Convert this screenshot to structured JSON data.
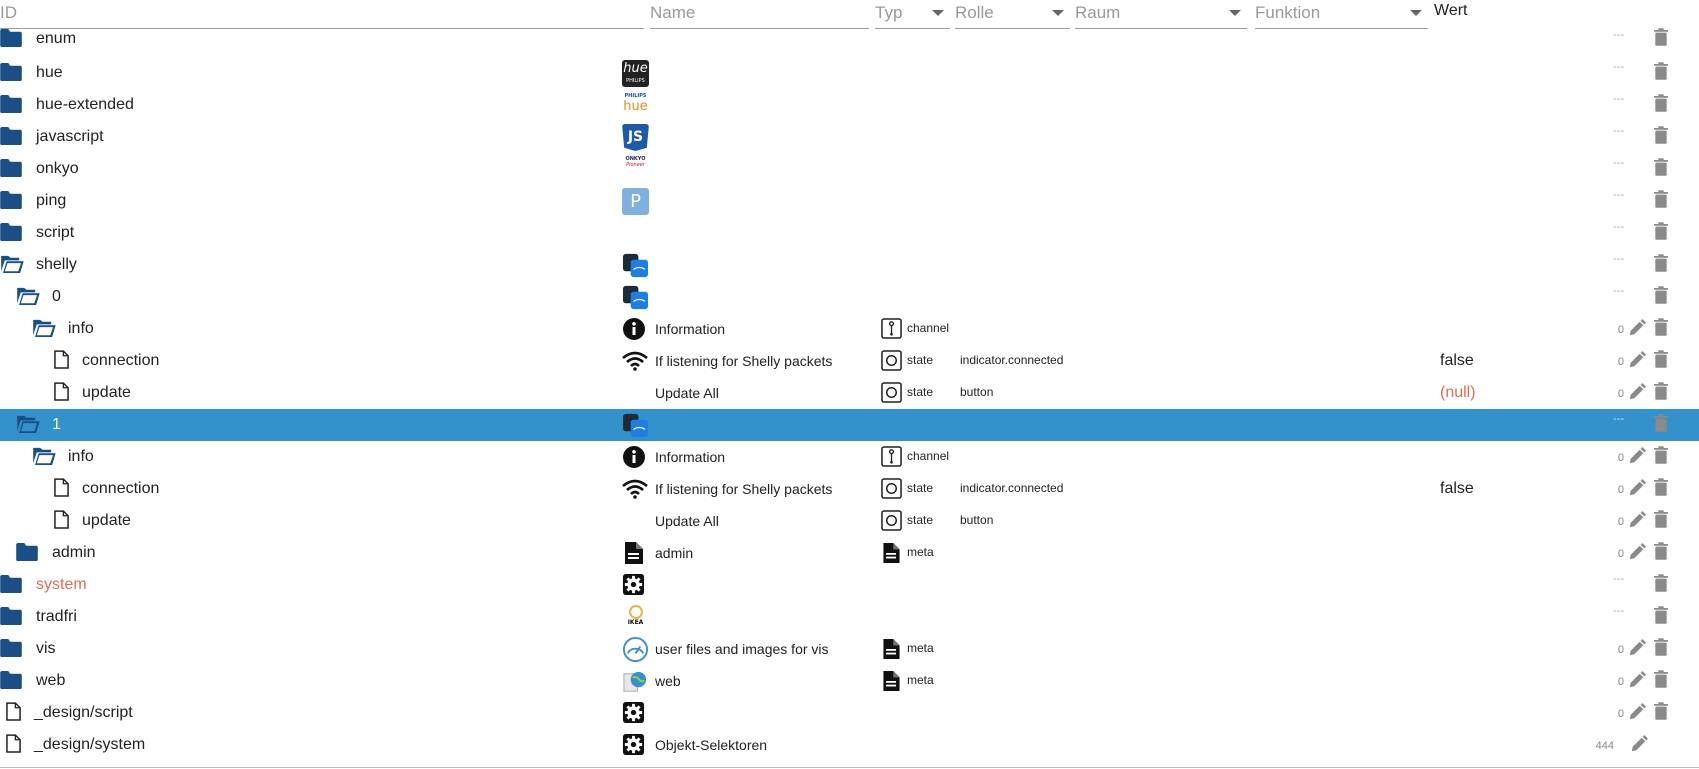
{
  "header": {
    "id": "ID",
    "name": "Name",
    "typ": "Typ",
    "rolle": "Rolle",
    "raum": "Raum",
    "funktion": "Funktion",
    "wert": "Wert"
  },
  "rows": [
    {
      "id": "enum",
      "acl": "---"
    },
    {
      "id": "hue",
      "acl": "---",
      "logo_text": "hue",
      "logo_sub": "PHILIPS"
    },
    {
      "id": "hue-extended",
      "acl": "---",
      "logo_text": "hue",
      "logo_sub": "PHILIPS"
    },
    {
      "id": "javascript",
      "acl": "---",
      "logo_text": "JS"
    },
    {
      "id": "onkyo",
      "acl": "---",
      "logo_text": "ONKYO",
      "logo_sub": "Pioneer"
    },
    {
      "id": "ping",
      "acl": "---",
      "logo_text": "P"
    },
    {
      "id": "script",
      "acl": "---"
    },
    {
      "id": "shelly",
      "acl": "---"
    },
    {
      "id": "0",
      "acl": "---"
    },
    {
      "id": "info",
      "name": "Information",
      "type": "channel",
      "acl": "0"
    },
    {
      "id": "connection",
      "name": "If listening for Shelly packets",
      "type": "state",
      "role": "indicator.connected",
      "value": "false",
      "acl": "0"
    },
    {
      "id": "update",
      "name": "Update All",
      "type": "state",
      "role": "button",
      "value": "(null)",
      "acl": "0"
    },
    {
      "id": "1",
      "acl": "---"
    },
    {
      "id": "info",
      "name": "Information",
      "type": "channel",
      "acl": "0"
    },
    {
      "id": "connection",
      "name": "If listening for Shelly packets",
      "type": "state",
      "role": "indicator.connected",
      "value": "false",
      "acl": "0"
    },
    {
      "id": "update",
      "name": "Update All",
      "type": "state",
      "role": "button",
      "acl": "0"
    },
    {
      "id": "admin",
      "name": "admin",
      "type": "meta",
      "acl": "0"
    },
    {
      "id": "system",
      "acl": "---"
    },
    {
      "id": "tradfri",
      "acl": "---",
      "logo_sub": "IKEA"
    },
    {
      "id": "vis",
      "name": "user files and images for vis",
      "type": "meta",
      "acl": "0"
    },
    {
      "id": "web",
      "name": "web",
      "type": "meta",
      "acl": "0"
    },
    {
      "id": "_design/script",
      "acl": "0"
    },
    {
      "id": "_design/system",
      "name": "Objekt-Selektoren",
      "acl": "444"
    }
  ],
  "colors": {
    "selected_row": "#3392cb",
    "folder": "#1a4f86",
    "null_value": "#e06c5a",
    "system_text": "#e06c5a"
  },
  "icons": {
    "folder": "folder-icon",
    "folder_open": "folder-open-icon",
    "file": "file-icon",
    "info": "info-icon",
    "wifi": "wifi-icon",
    "gear": "gear-icon",
    "document": "document-icon",
    "channel": "channel-type-icon",
    "state": "state-type-icon",
    "edit": "pencil-icon",
    "delete": "trash-icon"
  }
}
